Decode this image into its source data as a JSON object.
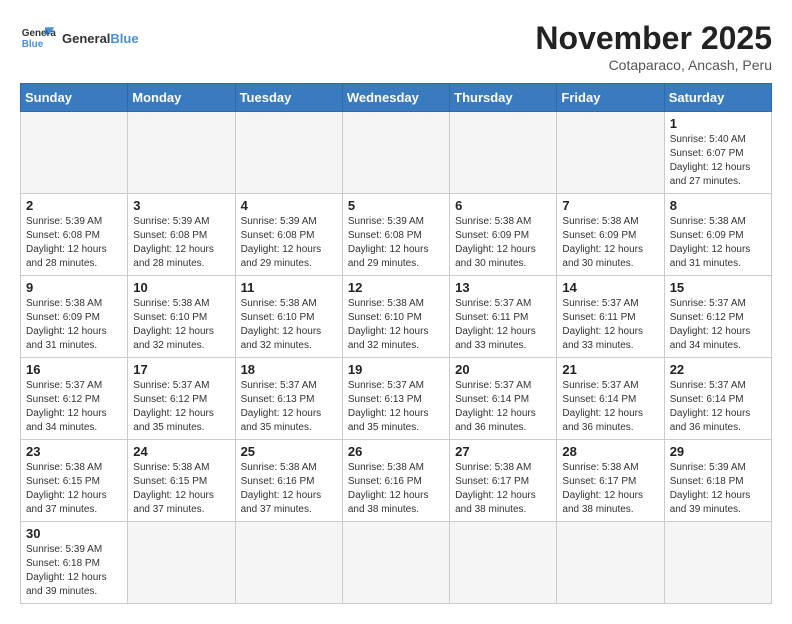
{
  "header": {
    "logo_general": "General",
    "logo_blue": "Blue",
    "month_title": "November 2025",
    "subtitle": "Cotaparaco, Ancash, Peru"
  },
  "weekdays": [
    "Sunday",
    "Monday",
    "Tuesday",
    "Wednesday",
    "Thursday",
    "Friday",
    "Saturday"
  ],
  "weeks": [
    [
      {
        "day": "",
        "info": ""
      },
      {
        "day": "",
        "info": ""
      },
      {
        "day": "",
        "info": ""
      },
      {
        "day": "",
        "info": ""
      },
      {
        "day": "",
        "info": ""
      },
      {
        "day": "",
        "info": ""
      },
      {
        "day": "1",
        "info": "Sunrise: 5:40 AM\nSunset: 6:07 PM\nDaylight: 12 hours and 27 minutes."
      }
    ],
    [
      {
        "day": "2",
        "info": "Sunrise: 5:39 AM\nSunset: 6:08 PM\nDaylight: 12 hours and 28 minutes."
      },
      {
        "day": "3",
        "info": "Sunrise: 5:39 AM\nSunset: 6:08 PM\nDaylight: 12 hours and 28 minutes."
      },
      {
        "day": "4",
        "info": "Sunrise: 5:39 AM\nSunset: 6:08 PM\nDaylight: 12 hours and 29 minutes."
      },
      {
        "day": "5",
        "info": "Sunrise: 5:39 AM\nSunset: 6:08 PM\nDaylight: 12 hours and 29 minutes."
      },
      {
        "day": "6",
        "info": "Sunrise: 5:38 AM\nSunset: 6:09 PM\nDaylight: 12 hours and 30 minutes."
      },
      {
        "day": "7",
        "info": "Sunrise: 5:38 AM\nSunset: 6:09 PM\nDaylight: 12 hours and 30 minutes."
      },
      {
        "day": "8",
        "info": "Sunrise: 5:38 AM\nSunset: 6:09 PM\nDaylight: 12 hours and 31 minutes."
      }
    ],
    [
      {
        "day": "9",
        "info": "Sunrise: 5:38 AM\nSunset: 6:09 PM\nDaylight: 12 hours and 31 minutes."
      },
      {
        "day": "10",
        "info": "Sunrise: 5:38 AM\nSunset: 6:10 PM\nDaylight: 12 hours and 32 minutes."
      },
      {
        "day": "11",
        "info": "Sunrise: 5:38 AM\nSunset: 6:10 PM\nDaylight: 12 hours and 32 minutes."
      },
      {
        "day": "12",
        "info": "Sunrise: 5:38 AM\nSunset: 6:10 PM\nDaylight: 12 hours and 32 minutes."
      },
      {
        "day": "13",
        "info": "Sunrise: 5:37 AM\nSunset: 6:11 PM\nDaylight: 12 hours and 33 minutes."
      },
      {
        "day": "14",
        "info": "Sunrise: 5:37 AM\nSunset: 6:11 PM\nDaylight: 12 hours and 33 minutes."
      },
      {
        "day": "15",
        "info": "Sunrise: 5:37 AM\nSunset: 6:12 PM\nDaylight: 12 hours and 34 minutes."
      }
    ],
    [
      {
        "day": "16",
        "info": "Sunrise: 5:37 AM\nSunset: 6:12 PM\nDaylight: 12 hours and 34 minutes."
      },
      {
        "day": "17",
        "info": "Sunrise: 5:37 AM\nSunset: 6:12 PM\nDaylight: 12 hours and 35 minutes."
      },
      {
        "day": "18",
        "info": "Sunrise: 5:37 AM\nSunset: 6:13 PM\nDaylight: 12 hours and 35 minutes."
      },
      {
        "day": "19",
        "info": "Sunrise: 5:37 AM\nSunset: 6:13 PM\nDaylight: 12 hours and 35 minutes."
      },
      {
        "day": "20",
        "info": "Sunrise: 5:37 AM\nSunset: 6:14 PM\nDaylight: 12 hours and 36 minutes."
      },
      {
        "day": "21",
        "info": "Sunrise: 5:37 AM\nSunset: 6:14 PM\nDaylight: 12 hours and 36 minutes."
      },
      {
        "day": "22",
        "info": "Sunrise: 5:37 AM\nSunset: 6:14 PM\nDaylight: 12 hours and 36 minutes."
      }
    ],
    [
      {
        "day": "23",
        "info": "Sunrise: 5:38 AM\nSunset: 6:15 PM\nDaylight: 12 hours and 37 minutes."
      },
      {
        "day": "24",
        "info": "Sunrise: 5:38 AM\nSunset: 6:15 PM\nDaylight: 12 hours and 37 minutes."
      },
      {
        "day": "25",
        "info": "Sunrise: 5:38 AM\nSunset: 6:16 PM\nDaylight: 12 hours and 37 minutes."
      },
      {
        "day": "26",
        "info": "Sunrise: 5:38 AM\nSunset: 6:16 PM\nDaylight: 12 hours and 38 minutes."
      },
      {
        "day": "27",
        "info": "Sunrise: 5:38 AM\nSunset: 6:17 PM\nDaylight: 12 hours and 38 minutes."
      },
      {
        "day": "28",
        "info": "Sunrise: 5:38 AM\nSunset: 6:17 PM\nDaylight: 12 hours and 38 minutes."
      },
      {
        "day": "29",
        "info": "Sunrise: 5:39 AM\nSunset: 6:18 PM\nDaylight: 12 hours and 39 minutes."
      }
    ],
    [
      {
        "day": "30",
        "info": "Sunrise: 5:39 AM\nSunset: 6:18 PM\nDaylight: 12 hours and 39 minutes."
      },
      {
        "day": "",
        "info": ""
      },
      {
        "day": "",
        "info": ""
      },
      {
        "day": "",
        "info": ""
      },
      {
        "day": "",
        "info": ""
      },
      {
        "day": "",
        "info": ""
      },
      {
        "day": "",
        "info": ""
      }
    ]
  ]
}
